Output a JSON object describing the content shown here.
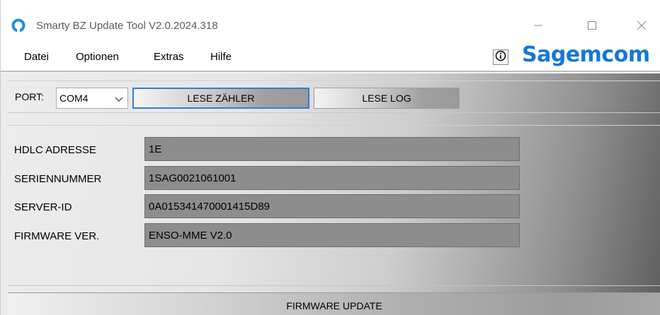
{
  "window": {
    "title": "Smarty BZ Update Tool V2.0.2024.318",
    "icon": "app-ring-icon",
    "controls": [
      "minimize-icon",
      "maximize-icon",
      "close-icon"
    ]
  },
  "menu": {
    "items": [
      "Datei",
      "Optionen",
      "Extras",
      "Hilfe"
    ],
    "info_icon": "info-icon",
    "logo": "Sagemcom",
    "logo_color": "#1577d6"
  },
  "toolbar": {
    "port_label": "PORT:",
    "port_value": "COM4",
    "read_meter_label": "LESE ZÄHLER",
    "read_log_label": "LESE LOG"
  },
  "fields": [
    {
      "label": "HDLC ADRESSE",
      "value": "1E"
    },
    {
      "label": "SERIENNUMMER",
      "value": "1SAG0021061001"
    },
    {
      "label": "SERVER-ID",
      "value": "0A015341470001415D89"
    },
    {
      "label": "FIRMWARE VER.",
      "value": "ENSO-MME V2.0"
    }
  ],
  "firmware_button": "FIRMWARE UPDATE",
  "colors": {
    "accent_focus": "#2f7ed8"
  }
}
